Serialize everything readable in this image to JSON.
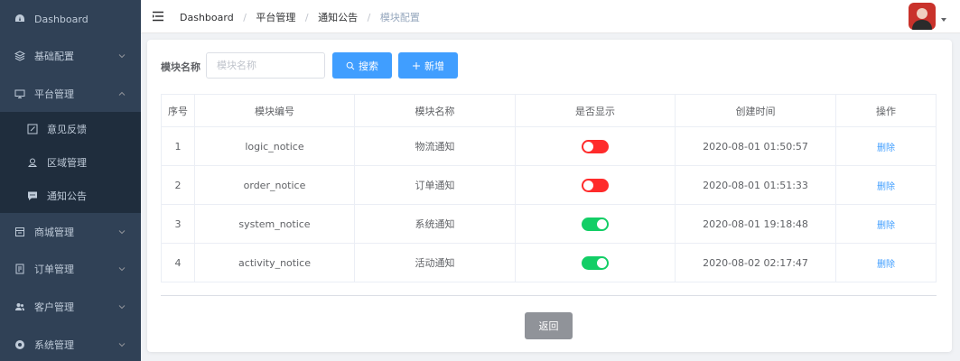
{
  "sidebar": {
    "items": [
      {
        "label": "Dashboard"
      },
      {
        "label": "基础配置"
      },
      {
        "label": "平台管理"
      },
      {
        "label": "商城管理"
      },
      {
        "label": "订单管理"
      },
      {
        "label": "客户管理"
      },
      {
        "label": "系统管理"
      }
    ],
    "submenu": [
      {
        "label": "意见反馈"
      },
      {
        "label": "区域管理"
      },
      {
        "label": "通知公告"
      }
    ]
  },
  "breadcrumb": [
    "Dashboard",
    "平台管理",
    "通知公告",
    "模块配置"
  ],
  "breadcrumb_separator": "/",
  "search": {
    "label": "模块名称",
    "placeholder": "模块名称",
    "search_button": "搜索",
    "add_button": "新增"
  },
  "table": {
    "headers": [
      "序号",
      "模块编号",
      "模块名称",
      "是否显示",
      "创建时间",
      "操作"
    ],
    "rows": [
      {
        "index": "1",
        "code": "logic_notice",
        "name": "物流通知",
        "visible": false,
        "created": "2020-08-01 01:50:57",
        "action": "删除"
      },
      {
        "index": "2",
        "code": "order_notice",
        "name": "订单通知",
        "visible": false,
        "created": "2020-08-01 01:51:33",
        "action": "删除"
      },
      {
        "index": "3",
        "code": "system_notice",
        "name": "系统通知",
        "visible": true,
        "created": "2020-08-01 19:18:48",
        "action": "删除"
      },
      {
        "index": "4",
        "code": "activity_notice",
        "name": "活动通知",
        "visible": true,
        "created": "2020-08-02 02:17:47",
        "action": "删除"
      }
    ]
  },
  "footer": {
    "back_button": "返回"
  },
  "colors": {
    "sidebar_bg": "#304156",
    "submenu_bg": "#1f2d3d",
    "primary": "#409eff",
    "switch_on": "#13ce66",
    "switch_off": "#ff2b2b",
    "back_button": "#909399"
  }
}
